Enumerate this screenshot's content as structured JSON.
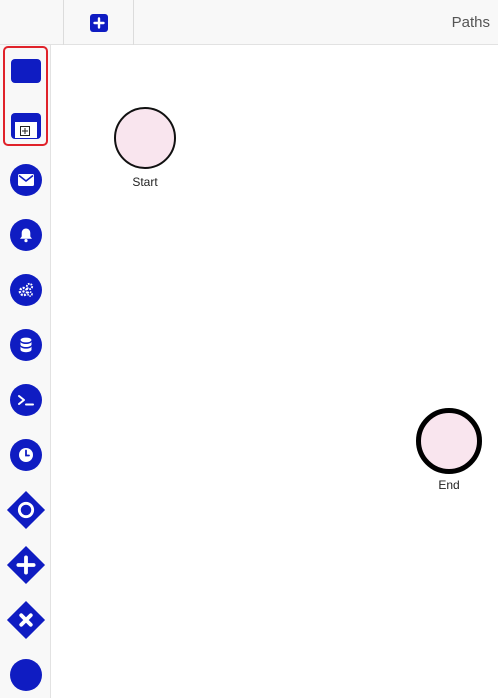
{
  "toolbar": {
    "title": "Paths",
    "add_icon": "plus-square-icon"
  },
  "palette": {
    "accent": "#0f1cc2",
    "selection_color": "#e0222a",
    "items": [
      {
        "name": "task-tool",
        "icon": "rounded-rect-icon"
      },
      {
        "name": "subprocess-tool",
        "icon": "subprocess-icon"
      },
      {
        "name": "message-event-tool",
        "icon": "envelope-icon"
      },
      {
        "name": "signal-event-tool",
        "icon": "bell-icon"
      },
      {
        "name": "service-task-tool",
        "icon": "gears-icon"
      },
      {
        "name": "data-store-tool",
        "icon": "database-icon"
      },
      {
        "name": "script-task-tool",
        "icon": "terminal-icon"
      },
      {
        "name": "timer-event-tool",
        "icon": "clock-icon"
      },
      {
        "name": "inclusive-gateway-tool",
        "icon": "gateway-circle-icon"
      },
      {
        "name": "parallel-gateway-tool",
        "icon": "gateway-plus-icon"
      },
      {
        "name": "exclusive-gateway-tool",
        "icon": "gateway-x-icon"
      },
      {
        "name": "event-tool",
        "icon": "circle-icon"
      }
    ]
  },
  "diagram": {
    "start_event": {
      "label": "Start",
      "fill": "#f9e5ee"
    },
    "end_event": {
      "label": "End",
      "fill": "#f9e5ee"
    }
  }
}
